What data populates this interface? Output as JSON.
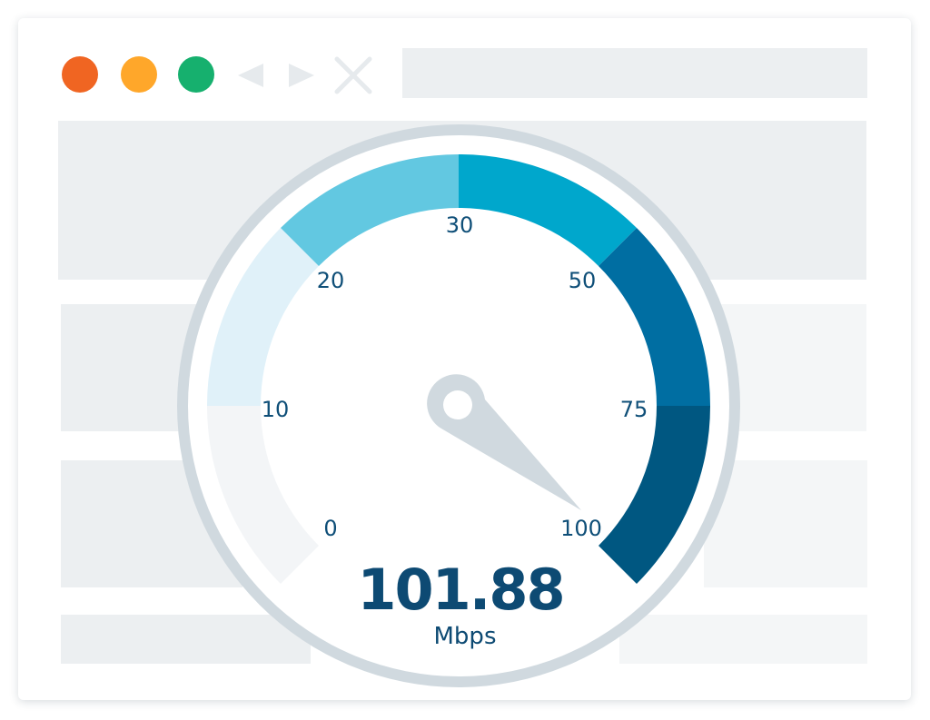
{
  "window": {
    "controls": [
      {
        "name": "close",
        "color": "#f06522"
      },
      {
        "name": "minimize",
        "color": "#ffa72a"
      },
      {
        "name": "maximize",
        "color": "#16b06e"
      }
    ],
    "icons": [
      "back-arrow-icon",
      "forward-arrow-icon",
      "close-x-icon"
    ]
  },
  "gauge": {
    "ticks": [
      {
        "value": "0",
        "name": "gauge-tick-0"
      },
      {
        "value": "10",
        "name": "gauge-tick-10"
      },
      {
        "value": "20",
        "name": "gauge-tick-20"
      },
      {
        "value": "30",
        "name": "gauge-tick-30"
      },
      {
        "value": "50",
        "name": "gauge-tick-50"
      },
      {
        "value": "75",
        "name": "gauge-tick-75"
      },
      {
        "value": "100",
        "name": "gauge-tick-100"
      }
    ],
    "segment_colors": [
      "#f3f5f7",
      "#e0f1f9",
      "#62c8e1",
      "#00a7cc",
      "#006ea2",
      "#005781"
    ],
    "reading": "101.88",
    "unit": "Mbps"
  }
}
